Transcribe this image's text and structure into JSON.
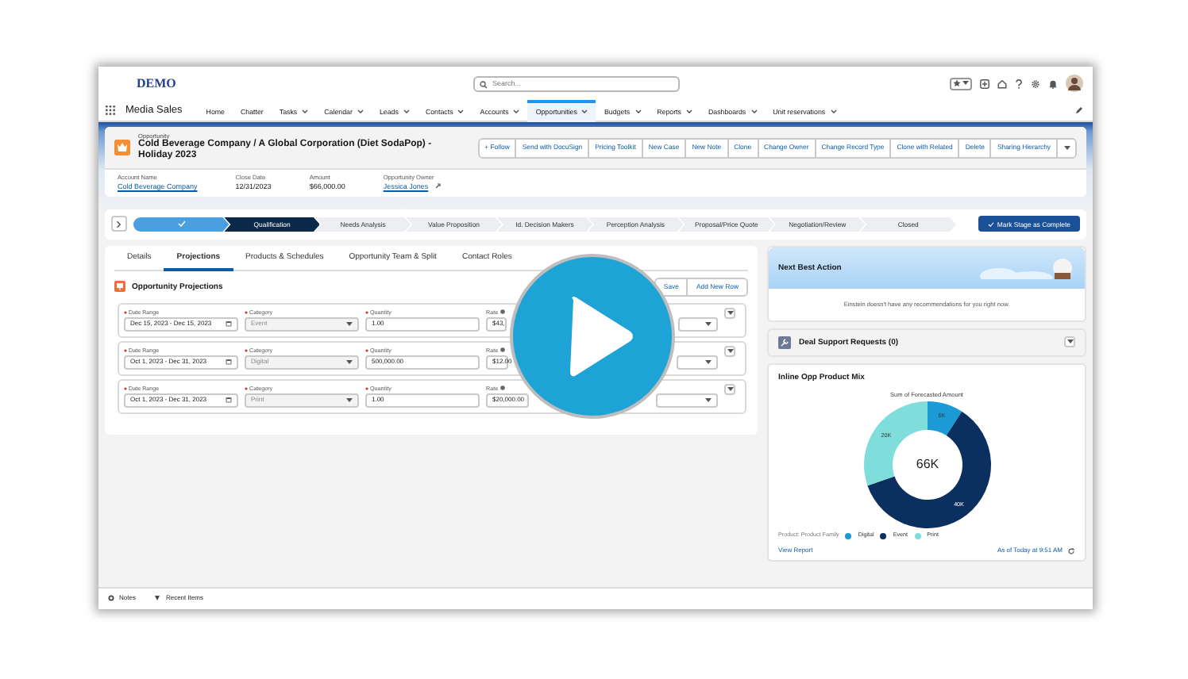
{
  "app": {
    "logo": "DEMO",
    "search_placeholder": "Search...",
    "name": "Media Sales"
  },
  "nav": [
    {
      "label": "Home",
      "menu": false,
      "selected": false
    },
    {
      "label": "Chatter",
      "menu": false,
      "selected": false
    },
    {
      "label": "Tasks",
      "menu": true,
      "selected": false
    },
    {
      "label": "Calendar",
      "menu": true,
      "selected": false
    },
    {
      "label": "Leads",
      "menu": true,
      "selected": false
    },
    {
      "label": "Contacts",
      "menu": true,
      "selected": false
    },
    {
      "label": "Accounts",
      "menu": true,
      "selected": false
    },
    {
      "label": "Opportunities",
      "menu": true,
      "selected": true
    },
    {
      "label": "Budgets",
      "menu": true,
      "selected": false
    },
    {
      "label": "Reports",
      "menu": true,
      "selected": false
    },
    {
      "label": "Dashboards",
      "menu": true,
      "selected": false
    },
    {
      "label": "Unit reservations",
      "menu": true,
      "selected": false
    }
  ],
  "record": {
    "type": "Opportunity",
    "title": "Cold Beverage Company / A Global Corporation (Diet SodaPop) - Holiday 2023",
    "actions": [
      "+ Follow",
      "Send with DocuSign",
      "Pricing Toolkit",
      "New Case",
      "New Note",
      "Clone",
      "Change Owner",
      "Change Record Type",
      "Clone with Related",
      "Delete",
      "Sharing Hierarchy"
    ],
    "fields": [
      {
        "label": "Account Name",
        "value": "Cold Beverage Company",
        "kind": "link"
      },
      {
        "label": "Close Date",
        "value": "12/31/2023",
        "kind": "text"
      },
      {
        "label": "Amount",
        "value": "$66,000.00",
        "kind": "text"
      },
      {
        "label": "Opportunity Owner",
        "value": "Jessica Jones",
        "kind": "owner"
      }
    ]
  },
  "path": {
    "stages": [
      {
        "completed": true,
        "selected": false
      },
      {
        "label": "Qualification",
        "completed": false,
        "selected": true
      },
      {
        "label": "Needs Analysis",
        "completed": false,
        "selected": false
      },
      {
        "label": "Value Proposition",
        "completed": false,
        "selected": false
      },
      {
        "label": "Id. Decision Makers",
        "completed": false,
        "selected": false
      },
      {
        "label": "Perception Analysis",
        "completed": false,
        "selected": false
      },
      {
        "label": "Proposal/Price Quote",
        "completed": false,
        "selected": false
      },
      {
        "label": "Negotiation/Review",
        "completed": false,
        "selected": false
      },
      {
        "label": "Closed",
        "completed": false,
        "selected": false
      }
    ],
    "button": "Mark Stage as Complete"
  },
  "tabs": [
    {
      "label": "Details",
      "selected": false
    },
    {
      "label": "Projections",
      "selected": true
    },
    {
      "label": "Products & Schedules",
      "selected": false
    },
    {
      "label": "Opportunity Team & Split",
      "selected": false
    },
    {
      "label": "Contact Roles",
      "selected": false
    }
  ],
  "projections": {
    "title": "Opportunity Projections",
    "buttons": [
      "Save",
      "Add New Row"
    ],
    "rows": [
      {
        "fields": [
          {
            "label": "Date Range",
            "value": "Dec 15, 2023 - Dec 15, 2023",
            "kind": "date",
            "required": true
          },
          {
            "label": "Category",
            "value": "Event",
            "kind": "select",
            "required": true,
            "disabled": true
          },
          {
            "label": "Quantity",
            "value": "1.00",
            "kind": "text",
            "required": true
          },
          {
            "label": "Rate",
            "value": "$43,",
            "kind": "rate",
            "required": false
          }
        ]
      },
      {
        "fields": [
          {
            "label": "Date Range",
            "value": "Oct 1, 2023 - Dec 31, 2023",
            "kind": "date",
            "required": true
          },
          {
            "label": "Category",
            "value": "Digital",
            "kind": "select",
            "required": true,
            "disabled": true
          },
          {
            "label": "Quantity",
            "value": "500,000.00",
            "kind": "text",
            "required": true
          },
          {
            "label": "Rate",
            "value": "$12.00",
            "kind": "rate",
            "required": false
          }
        ]
      },
      {
        "fields": [
          {
            "label": "Date Range",
            "value": "Oct 1, 2023 - Dec 31, 2023",
            "kind": "date",
            "required": true
          },
          {
            "label": "Category",
            "value": "Print",
            "kind": "select",
            "required": true,
            "disabled": true
          },
          {
            "label": "Quantity",
            "value": "1.00",
            "kind": "text",
            "required": true
          },
          {
            "label": "Rate",
            "value": "$20,000.00",
            "kind": "rate",
            "required": false
          }
        ]
      }
    ]
  },
  "next_best_action": {
    "title": "Next Best Action",
    "message": "Einstein doesn't have any recommendations for you right now."
  },
  "deal_support": {
    "title": "Deal Support Requests (0)"
  },
  "chart": {
    "title": "Inline Opp Product Mix",
    "center_label": "66K",
    "chart_data": {
      "type": "donut",
      "title": "Sum of Forecasted Amount",
      "categories": [
        "Digital",
        "Event",
        "Print"
      ],
      "values": [
        6,
        40,
        20
      ],
      "value_labels": [
        "6K",
        "40K",
        "20K"
      ]
    },
    "legend": {
      "title": "Product: Product Family",
      "items": [
        {
          "color": "#1b9ad6"
        },
        {
          "color": "#0b2f5e"
        },
        {
          "color": "#7fdedb"
        }
      ]
    },
    "link": "View Report",
    "timestamp": "As of Today at 9:51 AM"
  },
  "utility_bar": [
    {
      "label": "Notes",
      "kind": "notes"
    },
    {
      "label": "Recent Items",
      "kind": "recent"
    }
  ]
}
